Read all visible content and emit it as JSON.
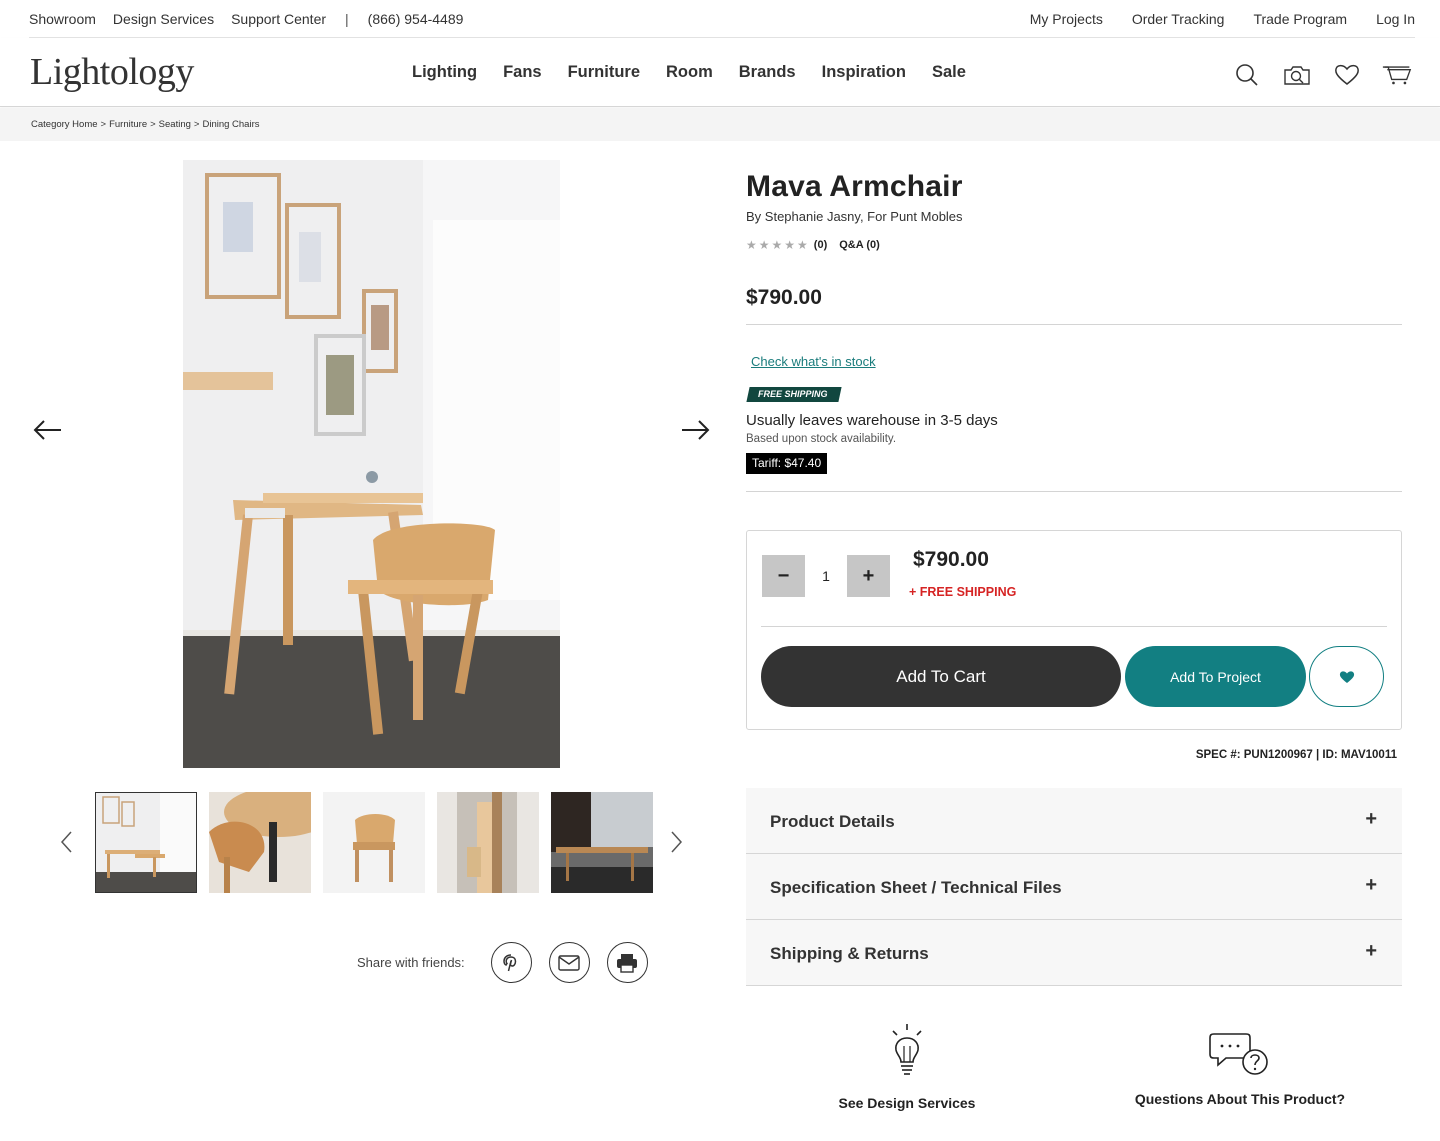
{
  "utility": {
    "left": [
      "Showroom",
      "Design Services",
      "Support Center"
    ],
    "separator": "|",
    "phone": "(866) 954-4489",
    "right": [
      "My Projects",
      "Order Tracking",
      "Trade Program",
      "Log In"
    ]
  },
  "nav": {
    "logo": "Lightology",
    "links": [
      "Lighting",
      "Fans",
      "Furniture",
      "Room",
      "Brands",
      "Inspiration",
      "Sale"
    ],
    "icons": [
      "search-icon",
      "camera-search-icon",
      "heart-icon",
      "cart-icon"
    ]
  },
  "breadcrumb": [
    "Category Home",
    ">",
    "Furniture",
    ">",
    "Seating",
    ">",
    "Dining Chairs"
  ],
  "product": {
    "title": "Mava Armchair",
    "byline": "By Stephanie Jasny, For Punt Mobles",
    "stars": "★★★★★",
    "rating_count": "(0)",
    "qa": "Q&A (0)",
    "price": "$790.00",
    "stock_link": "Check what's in stock",
    "free_shipping_badge": "FREE SHIPPING",
    "leaves": "Usually leaves warehouse in 3-5 days",
    "based_on": "Based upon stock availability.",
    "tariff": "Tariff: $47.40"
  },
  "cart": {
    "minus": "−",
    "qty": "1",
    "plus": "+",
    "price": "$790.00",
    "free_shipping": "+ FREE SHIPPING",
    "add_to_cart": "Add To Cart",
    "add_to_project": "Add To Project"
  },
  "spec": "SPEC #: PUN1200967 | ID: MAV10011",
  "accordion": [
    "Product Details",
    "Specification Sheet / Technical Files",
    "Shipping & Returns"
  ],
  "accordion_plus": "+",
  "share": {
    "label": "Share with friends:"
  },
  "help": [
    "See Design Services",
    "Questions About This Product?"
  ],
  "colors": {
    "teal": "#127f82",
    "dark": "#333333",
    "red": "#d62424",
    "badge": "#11473f"
  }
}
